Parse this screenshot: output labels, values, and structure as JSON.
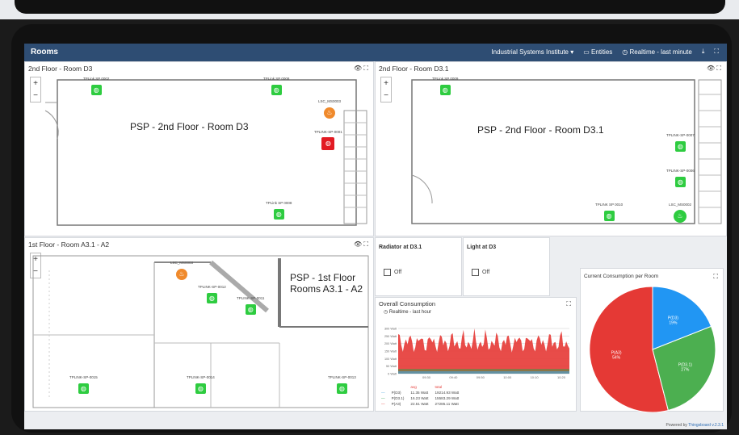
{
  "header": {
    "title": "Rooms",
    "org": "Industrial Systems Institute",
    "entities": "Entities",
    "time": "Realtime - last minute"
  },
  "cards": {
    "d3": {
      "title": "2nd Floor - Room D3",
      "room_label": "PSP - 2nd Floor - Room D3"
    },
    "d31": {
      "title": "2nd Floor - Room D3.1",
      "room_label": "PSP - 2nd Floor - Room D3.1"
    },
    "a31": {
      "title": "1st Floor - Room A3.1 - A2",
      "room_label_1": "PSP - 1st Floor",
      "room_label_2": "Rooms A3.1 - A2"
    },
    "radiator": {
      "title": "Radiator at D3.1",
      "state": "Off"
    },
    "light": {
      "title": "Light at D3",
      "state": "Off"
    },
    "overall": {
      "title": "Overall Consumption",
      "subtitle": "Realtime - last hour"
    },
    "pie": {
      "title": "Current Consumption per Room"
    }
  },
  "sensors": {
    "d3": [
      "TPLink SP 0002",
      "TPLink SP 0008",
      "LSC_MS0003",
      "TPLINK-SP-0001",
      "TPLink SP 0008"
    ],
    "d31": [
      "TPLink SP 0009",
      "TPLINK-SP-0007",
      "TPLINK-SP-0006",
      "TPLINK SP 0010",
      "LSC_MS0002"
    ],
    "a31": [
      "LSC_MS0003",
      "TPLINK-SP-0012",
      "TPLINK-SP-0011",
      "TPLINK-SP-0015",
      "TPLINK-SP-0014",
      "TPLINK-SP-0013"
    ]
  },
  "chart_data": [
    {
      "type": "area",
      "title": "Overall Consumption",
      "y_ticks": [
        "300 Watt",
        "250 Watt",
        "200 Watt",
        "150 Watt",
        "100 Watt",
        "50 Watt",
        "0 Watt"
      ],
      "x_ticks": [
        "09:30",
        "09:40",
        "09:50",
        "10:00",
        "10:10",
        "10:20"
      ],
      "ylim": [
        0,
        300
      ],
      "series": [
        {
          "name": "P(D3)",
          "color": "#4aa3df",
          "avg": "11.35 Watt",
          "total": "19214.93 Watt"
        },
        {
          "name": "P(D3.1)",
          "color": "#2ea043",
          "avg": "16.23 Watt",
          "total": "15583.29 Watt"
        },
        {
          "name": "P(A3)",
          "color": "#e53935",
          "avg": "22.51 Watt",
          "total": "27285.11 Watt"
        }
      ],
      "legend_headers": [
        "avg",
        "total"
      ]
    },
    {
      "type": "pie",
      "title": "Current Consumption per Room",
      "slices": [
        {
          "name": "P(A3)",
          "value": 54,
          "label": "54%",
          "color": "#e53935"
        },
        {
          "name": "P(D3.1)",
          "value": 27,
          "label": "27%",
          "color": "#4caf50"
        },
        {
          "name": "P(D3)",
          "value": 19,
          "label": "19%",
          "color": "#2196f3"
        }
      ]
    }
  ],
  "footer": {
    "powered": "Powered by",
    "brand": "Thingsboard v.2.3.1"
  }
}
